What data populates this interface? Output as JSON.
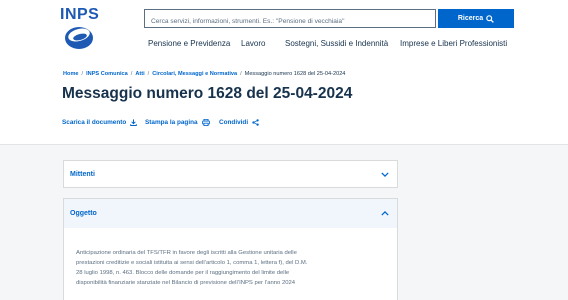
{
  "header": {
    "logo_text": "INPS",
    "search": {
      "placeholder": "Cerca servizi, informazioni, strumenti. Es.: \"Pensione di vecchiaia\"",
      "button_label": "Ricerca"
    },
    "nav": [
      {
        "label": "Pensione e Previdenza"
      },
      {
        "label": "Lavoro"
      },
      {
        "label": "Sostegni, Sussidi e Indennità"
      },
      {
        "label": "Imprese e Liberi Professionisti"
      }
    ]
  },
  "breadcrumb": {
    "items": [
      "Home",
      "INPS Comunica",
      "Atti",
      "Circolari, Messaggi e Normativa"
    ],
    "current": "Messaggio numero 1628 del 25-04-2024"
  },
  "page_title": "Messaggio numero 1628 del 25-04-2024",
  "actions": {
    "download": "Scarica il documento",
    "print": "Stampa la pagina",
    "share": "Condividi"
  },
  "accordions": [
    {
      "title": "Mittenti",
      "expanded": false
    },
    {
      "title": "Oggetto",
      "expanded": true,
      "body_lines": [
        "Anticipazione ordinaria del TFS/TFR in favore degli iscritti alla Gestione unitaria delle",
        "prestazioni creditizie e sociali istituita ai sensi dell’articolo 1, comma 1, lettera f), del D.M.",
        "28 luglio 1998, n. 463. Blocco delle domande per il raggiungimento del limite delle",
        "disponibilità finanziarie stanziate nel Bilancio di previsione dell’INPS per l’anno 2024"
      ]
    }
  ],
  "colors": {
    "brand_blue": "#0066cc",
    "logo_blue": "#1e5ab4",
    "text_dark": "#17324d",
    "text_gray": "#5c6f82",
    "page_gray": "#f5f6f7"
  },
  "icons": {
    "search": "search-icon",
    "download": "download-icon",
    "print": "print-icon",
    "share": "share-icon",
    "expand": "chevron-down-icon",
    "collapse": "chevron-up-icon"
  }
}
